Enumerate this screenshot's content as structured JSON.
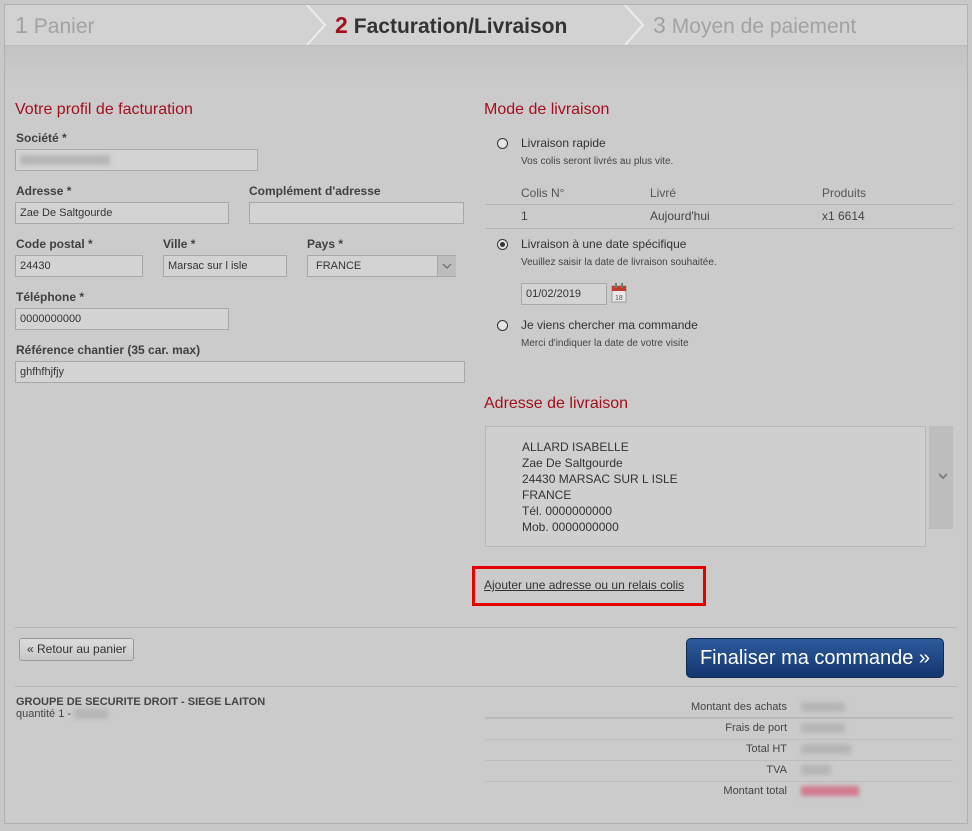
{
  "steps": [
    {
      "num": "1",
      "label": "Panier"
    },
    {
      "num": "2",
      "label": "Facturation/Livraison"
    },
    {
      "num": "3",
      "label": "Moyen de paiement"
    }
  ],
  "billing": {
    "title": "Votre profil de facturation",
    "societe_label": "Société *",
    "adresse_label": "Adresse *",
    "adresse_value": "Zae De Saltgourde",
    "complement_label": "Complément d'adresse",
    "complement_value": "",
    "cp_label": "Code postal *",
    "cp_value": "24430",
    "ville_label": "Ville *",
    "ville_value": "Marsac sur l isle",
    "pays_label": "Pays *",
    "pays_value": "FRANCE",
    "tel_label": "Téléphone *",
    "tel_value": "0000000000",
    "ref_label": "Référence chantier (35 car. max)",
    "ref_value": "ghfhfhjfjy"
  },
  "delivery": {
    "title": "Mode de livraison",
    "opt1_label": "Livraison rapide",
    "opt1_sub": "Vos colis seront livrés au plus vite.",
    "table": {
      "headers": [
        "Colis N°",
        "Livré",
        "Produits"
      ],
      "row": [
        "1",
        "Aujourd'hui",
        "x1 6614"
      ]
    },
    "opt2_label": "Livraison à une date spécifique",
    "opt2_sub": "Veuillez saisir la date de livraison souhaitée.",
    "date_value": "01/02/2019",
    "opt3_label": "Je viens chercher ma commande",
    "opt3_sub": "Merci d'indiquer la date de votre visite"
  },
  "address": {
    "title": "Adresse de livraison",
    "lines": [
      "ALLARD ISABELLE",
      "Zae De Saltgourde",
      "24430 MARSAC SUR L ISLE",
      "FRANCE",
      "Tél. 0000000000",
      "Mob. 0000000000"
    ],
    "add_link": "Ajouter une adresse ou un relais colis"
  },
  "actions": {
    "back_label": "« Retour au panier",
    "final_label": "Finaliser ma commande »"
  },
  "footer": {
    "product_name": "GROUPE DE SECURITE DROIT - SIEGE LAITON",
    "quantity_label": "quantité 1 -"
  },
  "totals": {
    "labels": [
      "Montant des achats",
      "Frais de port",
      "Total HT",
      "TVA",
      "Montant total"
    ]
  },
  "colors": {
    "accent": "#a30f1c",
    "button_blue": "#12366e",
    "highlight_red": "#e60000"
  }
}
